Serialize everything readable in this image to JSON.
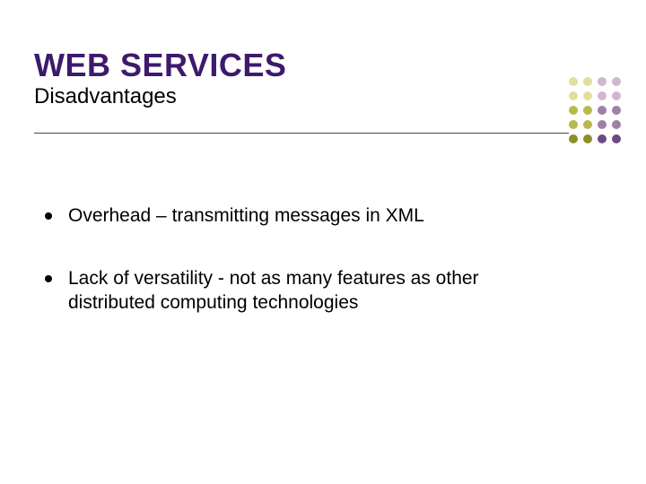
{
  "header": {
    "title": "WEB SERVICES",
    "subtitle": "Disadvantages"
  },
  "bullets": [
    "Overhead – transmitting messages in XML",
    "Lack of versatility - not as many features as other distributed computing technologies"
  ],
  "decor": {
    "dot_colors": [
      "#e1e09a",
      "#e1e09a",
      "#d0b6cf",
      "#d0b6cf",
      "#e1e09a",
      "#e1e09a",
      "#d0b6cf",
      "#d0b6cf",
      "#b9b84b",
      "#b9b84b",
      "#a07fa8",
      "#a07fa8",
      "#b9b84b",
      "#b9b84b",
      "#a07fa8",
      "#a07fa8",
      "#8e8e2a",
      "#8e8e2a",
      "#6c4a84",
      "#6c4a84"
    ]
  }
}
